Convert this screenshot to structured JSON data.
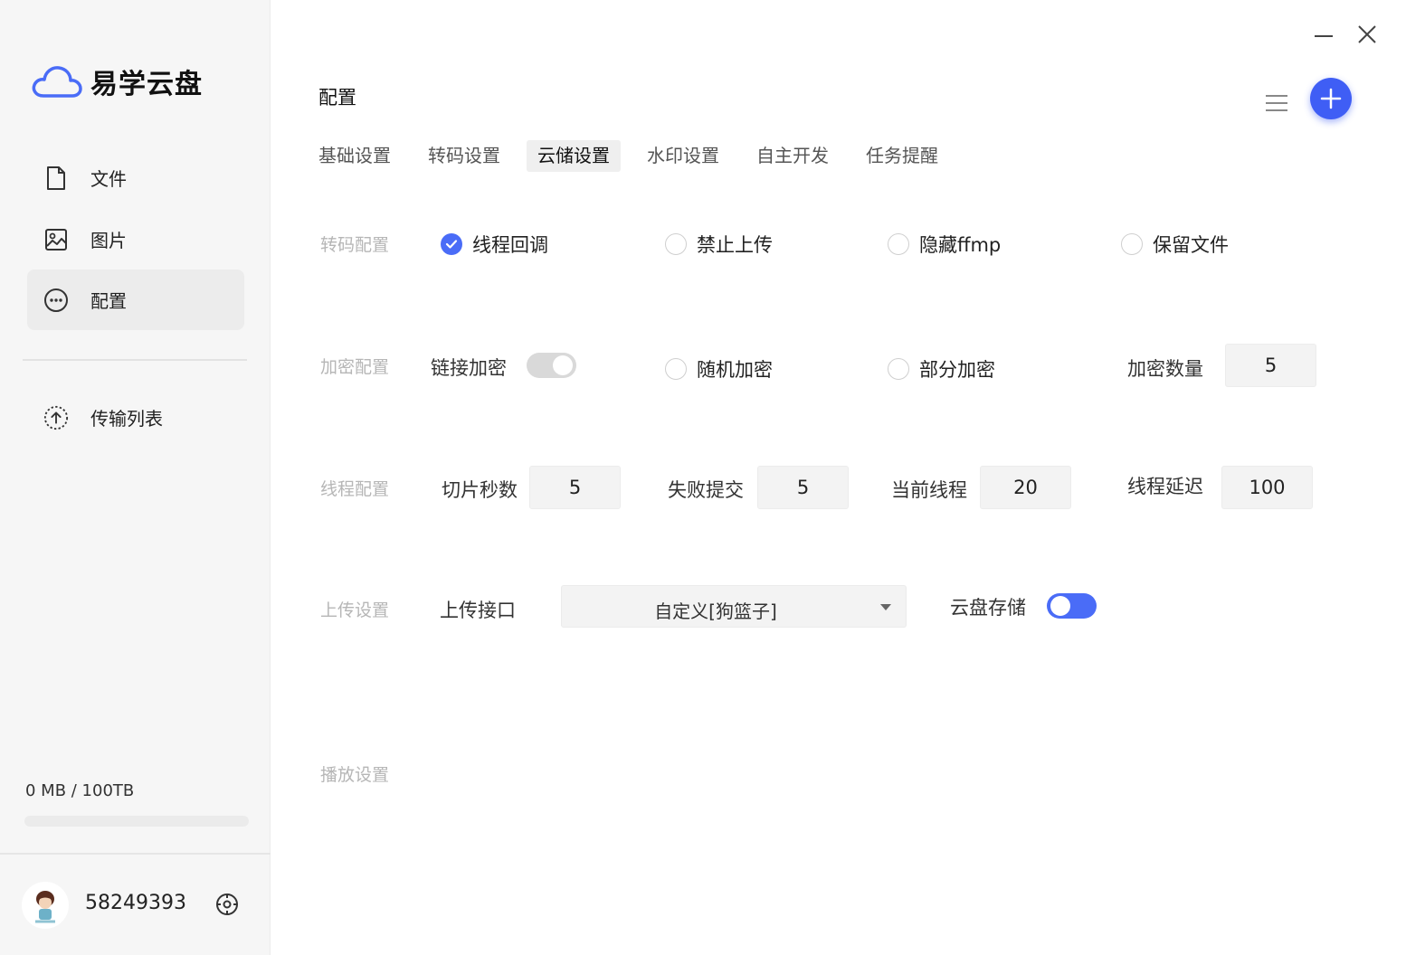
{
  "app": {
    "name": "易学云盘"
  },
  "sidebar": {
    "items": [
      {
        "label": "文件",
        "icon": "file-icon"
      },
      {
        "label": "图片",
        "icon": "image-icon"
      },
      {
        "label": "配置",
        "icon": "more-icon",
        "active": true
      }
    ],
    "transfer": {
      "label": "传输列表",
      "icon": "upload-icon"
    },
    "storage": {
      "text": "0 MB / 100TB",
      "used_fraction": 0
    },
    "user": {
      "name": "58249393"
    }
  },
  "main": {
    "title": "配置",
    "tabs": [
      {
        "label": "基础设置"
      },
      {
        "label": "转码设置"
      },
      {
        "label": "云储设置",
        "active": true
      },
      {
        "label": "水印设置"
      },
      {
        "label": "自主开发"
      },
      {
        "label": "任务提醒"
      }
    ],
    "transcode": {
      "label": "转码配置",
      "options": [
        {
          "label": "线程回调",
          "checked": true
        },
        {
          "label": "禁止上传",
          "checked": false
        },
        {
          "label": "隐藏ffmp",
          "checked": false
        },
        {
          "label": "保留文件",
          "checked": false
        }
      ]
    },
    "encrypt": {
      "label": "加密配置",
      "link_encrypt_label": "链接加密",
      "link_encrypt_on": false,
      "random_label": "随机加密",
      "partial_label": "部分加密",
      "count_label": "加密数量",
      "count_value": "5"
    },
    "thread": {
      "label": "线程配置",
      "slice_label": "切片秒数",
      "slice_value": "5",
      "fail_label": "失败提交",
      "fail_value": "5",
      "current_label": "当前线程",
      "current_value": "20",
      "delay_label": "线程延迟",
      "delay_value": "100"
    },
    "upload": {
      "label": "上传设置",
      "api_label": "上传接口",
      "api_value": "自定义[狗篮子]",
      "cloud_label": "云盘存储",
      "cloud_on": true
    },
    "play": {
      "label": "播放设置"
    }
  },
  "colors": {
    "accent": "#4a6cf7",
    "sidebar_bg": "#f6f6f6"
  }
}
